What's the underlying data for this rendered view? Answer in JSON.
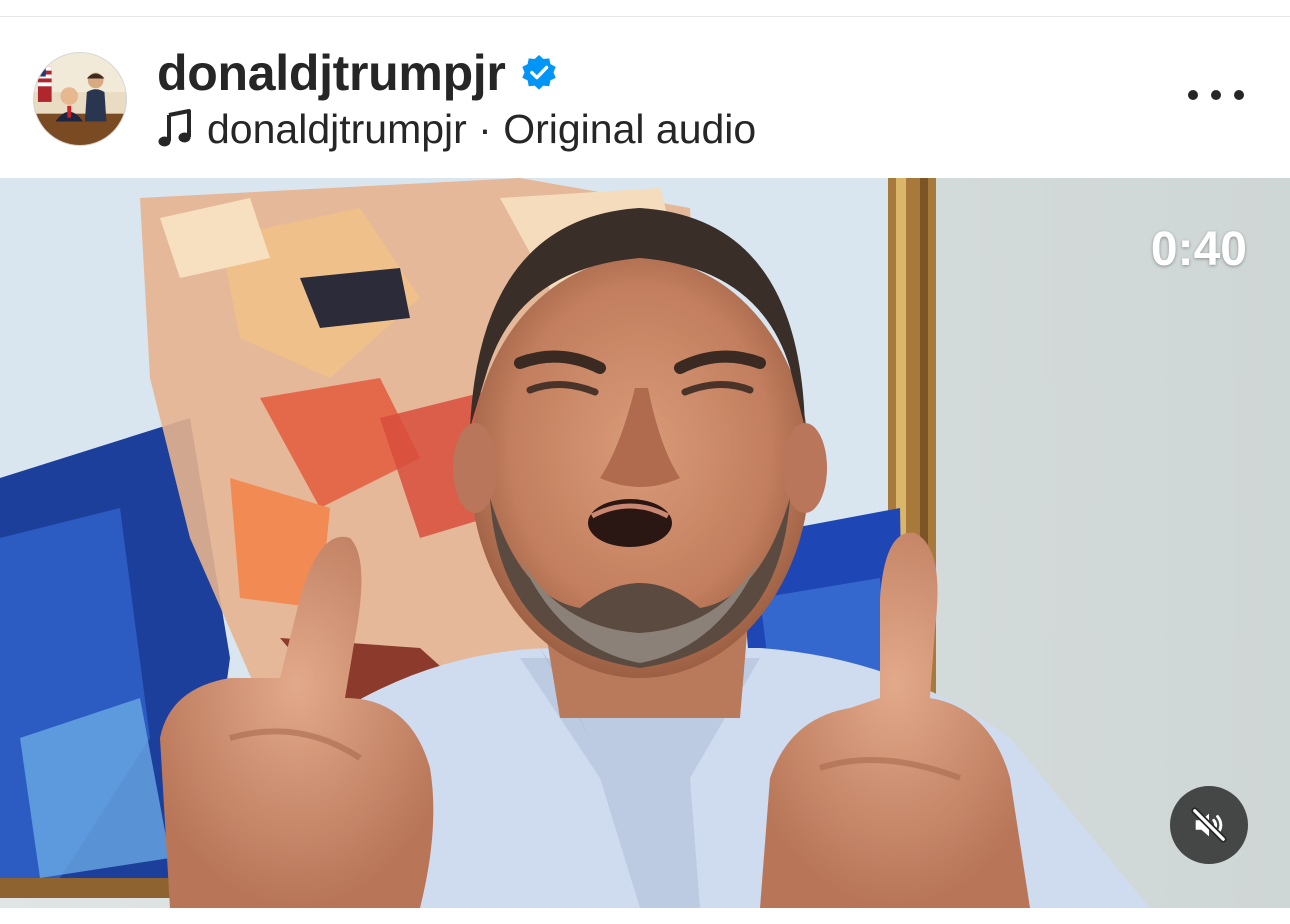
{
  "post": {
    "username": "donaldjtrumpjr",
    "verified": true,
    "audio_label": "donaldjtrumpjr · Original audio",
    "avatar_icon": "avatar",
    "more_icon": "more-horizontal-icon"
  },
  "video": {
    "duration": "0:40",
    "muted": true,
    "mute_icon": "speaker-muted-icon"
  },
  "colors": {
    "text": "#262626",
    "verified_blue": "#0095f6",
    "mute_bg": "#262626"
  }
}
